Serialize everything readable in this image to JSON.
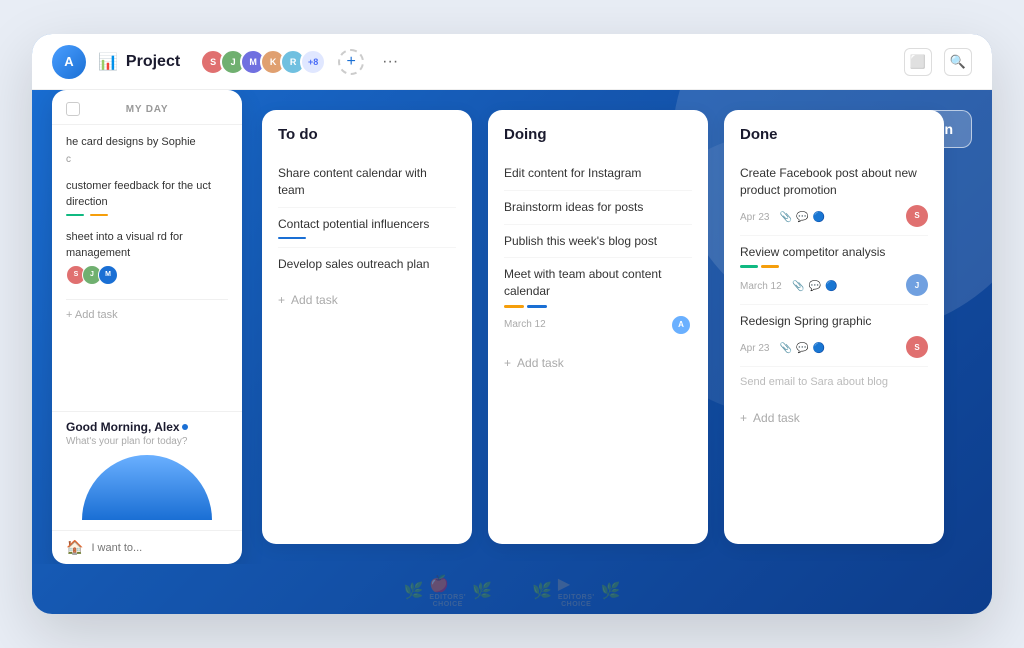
{
  "app": {
    "title": "Project"
  },
  "topbar": {
    "project_label": "Project",
    "avatar_count": "+8",
    "add_btn_label": "+",
    "more_btn_label": "···"
  },
  "my_day": {
    "header_label": "MY DAY",
    "greeting": "Good Morning, Alex",
    "plan_prompt": "What's your plan for today?",
    "tasks": [
      {
        "text": "he card designs by Sophie",
        "sub": "c"
      },
      {
        "text": "customer feedback for the uct direction",
        "sub": ""
      },
      {
        "text": "sheet into a visual rd for management",
        "sub": ""
      }
    ],
    "input_placeholder": "I want to...",
    "add_task_label": "+ Add task"
  },
  "columns": [
    {
      "id": "todo",
      "title": "To do",
      "tasks": [
        {
          "text": "Share content calendar with team",
          "underline": null,
          "date": null,
          "avatar_color": null
        },
        {
          "text": "Contact potential influencers",
          "underline": "blue",
          "date": null,
          "avatar_color": null
        },
        {
          "text": "Develop sales outreach plan",
          "underline": null,
          "date": null,
          "avatar_color": null
        }
      ],
      "add_label": "+ Add task"
    },
    {
      "id": "doing",
      "title": "Doing",
      "tasks": [
        {
          "text": "Edit content for Instagram",
          "underline": null,
          "date": null,
          "avatar_color": null
        },
        {
          "text": "Brainstorm ideas for posts",
          "underline": null,
          "date": null,
          "avatar_color": null
        },
        {
          "text": "Publish this week's blog post",
          "underline": null,
          "date": null,
          "avatar_color": null
        },
        {
          "text": "Meet with team about content calendar",
          "underline": "progress",
          "date": "March 12",
          "avatar_color": "#6ab0ff"
        }
      ],
      "add_label": "+ Add task"
    },
    {
      "id": "done",
      "title": "Done",
      "tasks": [
        {
          "text": "Create Facebook post about new product promotion",
          "underline": null,
          "date": "Apr 23",
          "avatar_color": "#e07070",
          "has_icons": true
        },
        {
          "text": "Review competitor analysis",
          "underline": "progress2",
          "date": "March 12",
          "avatar_color": "#70a0e0",
          "has_icons": true
        },
        {
          "text": "Redesign Spring graphic",
          "underline": null,
          "date": "Apr 23",
          "avatar_color": "#e07070",
          "has_icons": true
        },
        {
          "text": "Send email to Sara about blog",
          "underline": null,
          "date": null,
          "avatar_color": null
        }
      ],
      "add_label": "+ Add task"
    }
  ],
  "add_section": {
    "label": "+ Add section"
  },
  "awards": [
    {
      "label": "EDITORS'\nCHOICE",
      "icon": "🍎"
    },
    {
      "label": "EDITORS'\nCHOICE",
      "icon": "▶"
    }
  ]
}
